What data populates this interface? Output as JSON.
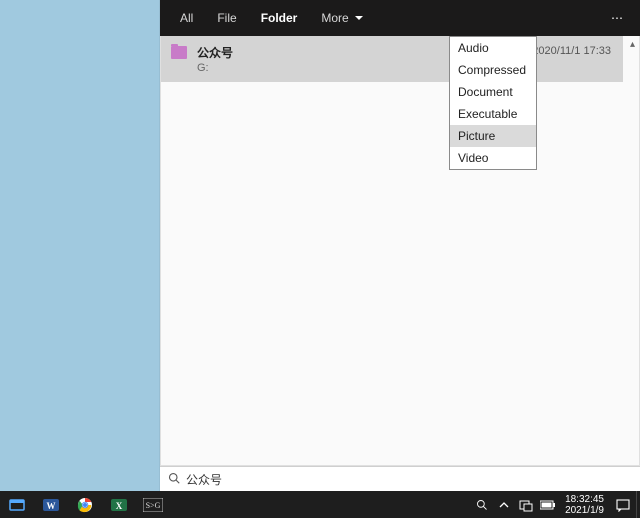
{
  "toolbar": {
    "tabs": {
      "all": "All",
      "file": "File",
      "folder": "Folder",
      "more": "More"
    }
  },
  "dropdown": {
    "items": [
      "Audio",
      "Compressed",
      "Document",
      "Executable",
      "Picture",
      "Video"
    ]
  },
  "list": {
    "items": [
      {
        "name": "公众号",
        "sub": "G:",
        "date": "2020/11/1 17:33"
      }
    ]
  },
  "search": {
    "value": "公众号"
  },
  "taskbar": {
    "time": "18:32:45",
    "date": "2021/1/9"
  }
}
